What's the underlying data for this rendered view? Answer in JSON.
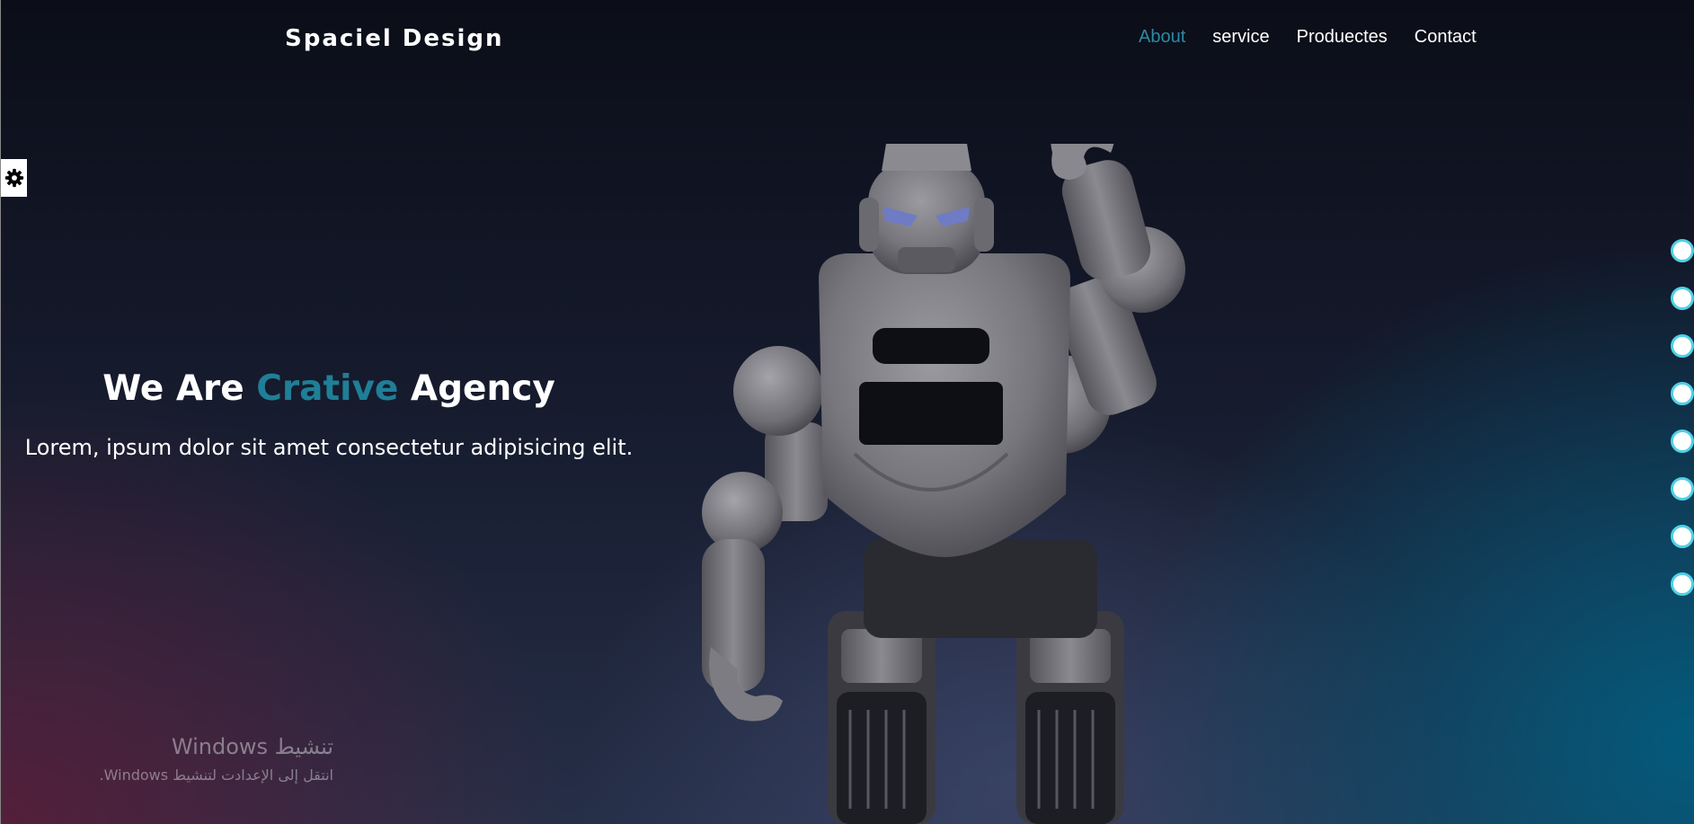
{
  "header": {
    "brand": "Spaciel Design",
    "nav": [
      {
        "label": "About",
        "active": true
      },
      {
        "label": "service",
        "active": false
      },
      {
        "label": "Produectes",
        "active": false
      },
      {
        "label": "Contact",
        "active": false
      }
    ]
  },
  "settings": {
    "icon": "gear-icon"
  },
  "hero": {
    "title_prefix": "We Are ",
    "title_accent": "Crative",
    "title_suffix": " Agency",
    "subtitle": "Lorem, ipsum dolor sit amet consectetur adipisicing elit.",
    "image": "robot-figure"
  },
  "bullets": {
    "count": 8
  },
  "watermark": {
    "title": "تنشيط Windows",
    "subtitle": "انتقل إلى الإعدادت لتنشيط Windows."
  },
  "colors": {
    "accent": "#1f7f97",
    "nav_active": "#2a8aa6",
    "bullet_border": "#4fd0e6"
  }
}
